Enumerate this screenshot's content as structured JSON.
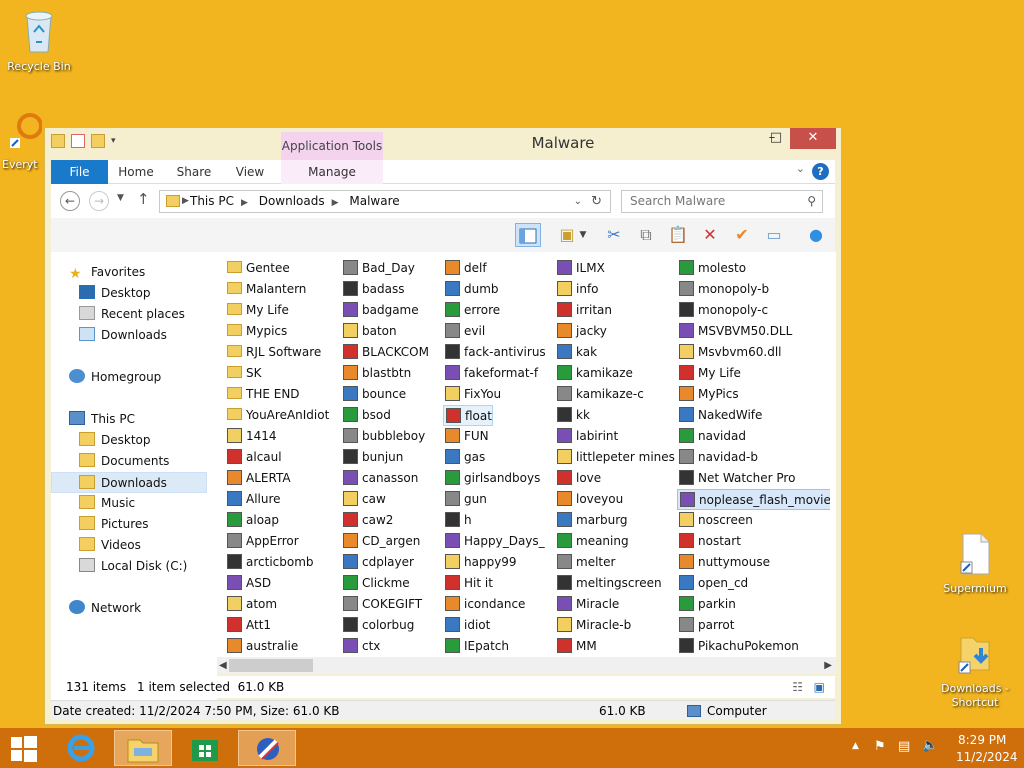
{
  "desktop": {
    "icons": [
      {
        "label": "Recycle Bin",
        "icon": "recycle-bin-icon"
      },
      {
        "label": "Everyt",
        "icon": "everything-icon"
      },
      {
        "label": "Supermium",
        "icon": "file-shortcut-icon"
      },
      {
        "label": "Downloads - Shortcut",
        "icon": "folder-shortcut-icon"
      }
    ]
  },
  "window": {
    "title": "Malware",
    "context_tab": "Application Tools",
    "controls": {
      "minimize": "–",
      "maximize": "□",
      "close": "✕"
    }
  },
  "ribbon": {
    "tabs": [
      "File",
      "Home",
      "Share",
      "View",
      "Manage"
    ],
    "help": "?"
  },
  "address": {
    "crumbs": [
      "This PC",
      "Downloads",
      "Malware"
    ],
    "search_placeholder": "Search Malware"
  },
  "nav": {
    "favorites": "Favorites",
    "fav_items": [
      "Desktop",
      "Recent places",
      "Downloads"
    ],
    "homegroup": "Homegroup",
    "thispc": "This PC",
    "pc_items": [
      "Desktop",
      "Documents",
      "Downloads",
      "Music",
      "Pictures",
      "Videos",
      "Local Disk (C:)"
    ],
    "network": "Network"
  },
  "files": {
    "columns": [
      [
        "Gentee",
        "Malantern",
        "My Life",
        "Mypics",
        "RJL Software",
        "SK",
        "THE END",
        "YouAreAnIdiot",
        "1414",
        "alcaul",
        "ALERTA",
        "Allure",
        "aloap",
        "AppError",
        "arcticbomb",
        "ASD",
        "atom",
        "Att1",
        "australie"
      ],
      [
        "Bad_Day",
        "badass",
        "badgame",
        "baton",
        "BLACKCOM",
        "blastbtn",
        "bounce",
        "bsod",
        "bubbleboy",
        "bunjun",
        "canasson",
        "caw",
        "caw2",
        "CD_argen",
        "cdplayer",
        "Clickme",
        "COKEGIFT",
        "colorbug",
        "ctx"
      ],
      [
        "delf",
        "dumb",
        "errore",
        "evil",
        "fack-antivirus",
        "fakeformat-f",
        "FixYou",
        "float",
        "FUN",
        "gas",
        "girlsandboys",
        "gun",
        "h",
        "Happy_Days_",
        "happy99",
        "Hit it",
        "icondance",
        "idiot",
        "IEpatch"
      ],
      [
        "ILMX",
        "info",
        "irritan",
        "jacky",
        "kak",
        "kamikaze",
        "kamikaze-c",
        "kk",
        "labirint",
        "littlepeter mines",
        "love",
        "loveyou",
        "marburg",
        "meaning",
        "melter",
        "meltingscreen",
        "Miracle",
        "Miracle-b",
        "MM"
      ],
      [
        "molesto",
        "monopoly-b",
        "monopoly-c",
        "MSVBVM50.DLL",
        "Msvbvm60.dll",
        "My Life",
        "MyPics",
        "NakedWife",
        "navidad",
        "navidad-b",
        "Net Watcher Pro",
        "noplease_flash_movie",
        "noscreen",
        "nostart",
        "nuttymouse",
        "open_cd",
        "parkin",
        "parrot",
        "PikachuPokemon"
      ]
    ]
  },
  "status": {
    "count": "131 items",
    "selected": "1 item selected  61.0 KB",
    "details": "Date created: 11/2/2024 7:50 PM, Size: 61.0 KB",
    "size": "61.0 KB",
    "location": "Computer"
  },
  "taskbar": {
    "time": "8:29 PM",
    "date": "11/2/2024"
  },
  "colors": {
    "desktop": "#f2b51f",
    "taskbar": "#ce6f0c",
    "accent": "#1979ca"
  }
}
